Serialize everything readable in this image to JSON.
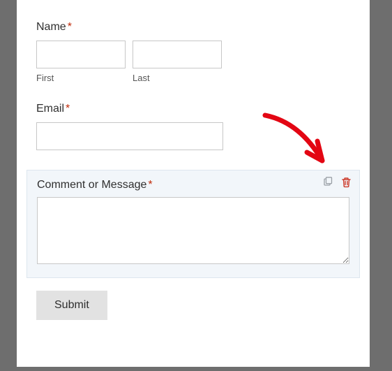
{
  "fields": {
    "name": {
      "label": "Name",
      "required": "*",
      "first_sub": "First",
      "last_sub": "Last",
      "first_value": "",
      "last_value": ""
    },
    "email": {
      "label": "Email",
      "required": "*",
      "value": ""
    },
    "comment": {
      "label": "Comment or Message",
      "required": "*",
      "value": ""
    }
  },
  "actions": {
    "duplicate": "duplicate",
    "delete": "delete"
  },
  "submit": {
    "label": "Submit"
  },
  "colors": {
    "required": "#c02b0a",
    "delete_icon": "#cc3a2a",
    "arrow": "#e30613",
    "panel_bg": "#ffffff",
    "page_bg": "#6e6e6e",
    "selected_bg": "#f2f6fa"
  }
}
